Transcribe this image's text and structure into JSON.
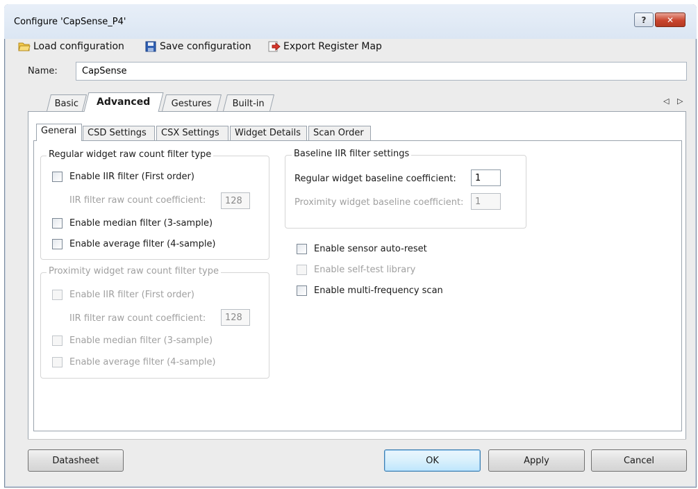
{
  "window": {
    "title": "Configure 'CapSense_P4'",
    "help_glyph": "?",
    "close_glyph": "✕"
  },
  "toolbar": {
    "load_label": "Load configuration",
    "save_label": "Save configuration",
    "export_label": "Export Register Map",
    "icons": [
      "folder-open-icon",
      "floppy-disk-icon",
      "export-arrow-icon"
    ]
  },
  "name": {
    "label": "Name:",
    "value": "CapSense"
  },
  "outer_tabs": [
    {
      "label": "Basic",
      "active": false
    },
    {
      "label": "Advanced",
      "active": true
    },
    {
      "label": "Gestures",
      "active": false
    },
    {
      "label": "Built-in",
      "active": false
    }
  ],
  "scroll_arrows": "◁ ▷",
  "inner_tabs": [
    {
      "label": "General",
      "active": true
    },
    {
      "label": "CSD Settings",
      "active": false
    },
    {
      "label": "CSX Settings",
      "active": false
    },
    {
      "label": "Widget Details",
      "active": false
    },
    {
      "label": "Scan Order",
      "active": false
    }
  ],
  "regular_filter": {
    "title": "Regular widget raw count filter type",
    "iir_label": "Enable IIR filter (First order)",
    "iir_coef_label": "IIR filter raw count coefficient:",
    "iir_coef_value": "128",
    "median_label": "Enable median filter (3-sample)",
    "average_label": "Enable average filter (4-sample)"
  },
  "proximity_filter": {
    "title": "Proximity widget raw count filter type",
    "iir_label": "Enable IIR filter (First order)",
    "iir_coef_label": "IIR filter raw count coefficient:",
    "iir_coef_value": "128",
    "median_label": "Enable median filter (3-sample)",
    "average_label": "Enable average filter (4-sample)"
  },
  "baseline": {
    "title": "Baseline IIR filter settings",
    "regular_label": "Regular widget baseline coefficient:",
    "regular_value": "1",
    "proximity_label": "Proximity widget baseline coefficient:",
    "proximity_value": "1"
  },
  "options": {
    "auto_reset_label": "Enable sensor auto-reset",
    "self_test_label": "Enable self-test library",
    "multi_freq_label": "Enable multi-frequency scan"
  },
  "buttons": {
    "datasheet": "Datasheet",
    "ok": "OK",
    "apply": "Apply",
    "cancel": "Cancel"
  }
}
